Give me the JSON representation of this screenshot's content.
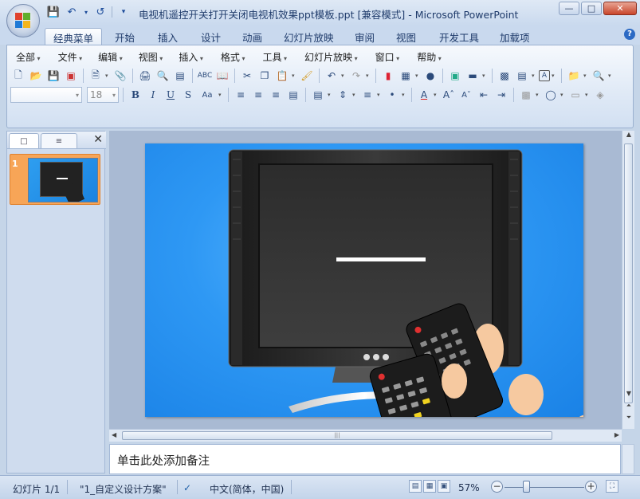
{
  "window": {
    "title": "电视机遥控开关打开关闭电视机效果ppt模板.ppt [兼容模式] - Microsoft PowerPoint",
    "controls": [
      "minimize",
      "maximize",
      "close"
    ]
  },
  "quick_access": [
    "save-icon",
    "undo-icon",
    "redo-icon",
    "customize-icon"
  ],
  "ribbon_tabs": [
    {
      "label": "经典菜单",
      "active": true
    },
    {
      "label": "开始"
    },
    {
      "label": "插入"
    },
    {
      "label": "设计"
    },
    {
      "label": "动画"
    },
    {
      "label": "幻灯片放映"
    },
    {
      "label": "审阅"
    },
    {
      "label": "视图"
    },
    {
      "label": "开发工具"
    },
    {
      "label": "加载项"
    }
  ],
  "classic_menu": [
    "全部",
    "文件",
    "编辑",
    "视图",
    "插入",
    "格式",
    "工具",
    "幻灯片放映",
    "窗口",
    "帮助"
  ],
  "font_box": {
    "font_name": "",
    "font_size": "18"
  },
  "left_pane": {
    "tabs": [
      "slides-tab",
      "outline-tab"
    ],
    "slide_number": "1"
  },
  "notes": {
    "placeholder": "单击此处添加备注"
  },
  "status": {
    "slide_info": "幻灯片 1/1",
    "theme": "\"1_自定义设计方案\"",
    "language": "中文(简体，中国)",
    "zoom": "57%",
    "zoom_level": 0.4
  },
  "colors": {
    "slide_background": "#2e98f4",
    "selected_thumb": "#f7a557",
    "ribbon": "#dfe9f6"
  }
}
